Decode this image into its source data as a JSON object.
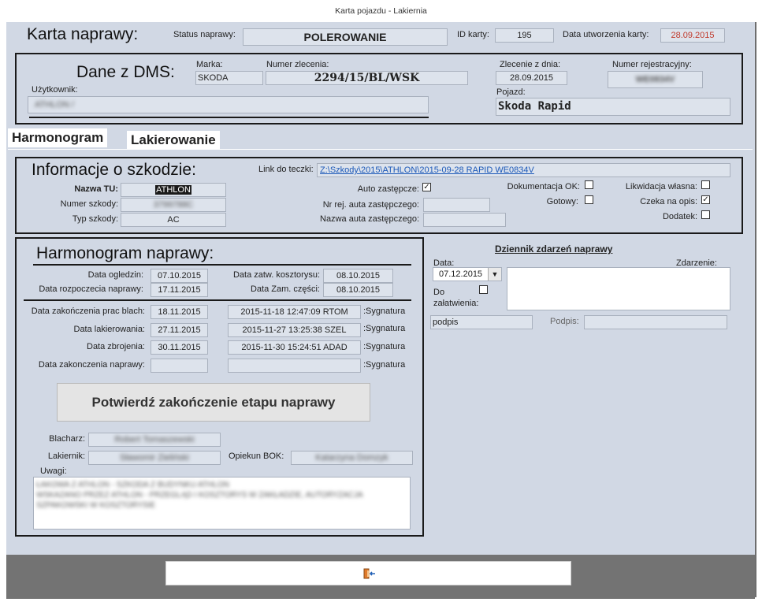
{
  "window": {
    "title": "Karta pojazdu - Lakiernia"
  },
  "header": {
    "title": "Karta naprawy:",
    "status_label": "Status naprawy:",
    "status_value": "POLEROWANIE",
    "id_label": "ID karty:",
    "id_value": "195",
    "created_label": "Data utworzenia karty:",
    "created_value": "28.09.2015",
    "created_color": "#c0392b"
  },
  "dms": {
    "title": "Dane z DMS:",
    "make_label": "Marka:",
    "make_value": "SKODA",
    "order_label": "Numer zlecenia:",
    "order_value": "2294/15/BL/WSK",
    "order_date_label": "Zlecenie z dnia:",
    "order_date_value": "28.09.2015",
    "reg_label": "Numer rejestracyjny:",
    "reg_value": "WE0834V",
    "user_label": "Użytkownik:",
    "user_value": "ATHLON /",
    "vehicle_label": "Pojazd:",
    "vehicle_value": "Skoda Rapid"
  },
  "tabs": [
    {
      "label": "Harmonogram"
    },
    {
      "label": "Lakierowanie"
    }
  ],
  "damage": {
    "title": "Informacje o szkodzie:",
    "link_label": "Link do teczki:",
    "link_value": "Z:\\Szkody\\2015\\ATHLON\\2015-09-28 RAPID WE0834V",
    "insurer_label": "Nazwa TU:",
    "insurer_value": "ATHLON",
    "claim_no_label": "Numer szkody:",
    "claim_no_value": "3799788C",
    "claim_type_label": "Typ szkody:",
    "claim_type_value": "AC",
    "rental_label": "Auto zastępcze:",
    "rental_checked": "✓",
    "rental_reg_label": "Nr rej. auta zastępczego:",
    "rental_reg_value": "",
    "rental_name_label": "Nazwa auta zastępczego:",
    "rental_name_value": "",
    "docs_label": "Dokumentacja OK:",
    "docs_checked": "",
    "ready_label": "Gotowy:",
    "ready_checked": "",
    "own_label": "Likwidacja własna:",
    "own_checked": "",
    "waiting_label": "Czeka na opis:",
    "waiting_checked": "✓",
    "extra_label": "Dodatek:",
    "extra_checked": ""
  },
  "schedule": {
    "title": "Harmonogram naprawy:",
    "inspection_label": "Data ogledzin:",
    "inspection_value": "07.10.2015",
    "cost_approved_label": "Data zatw. kosztorysu:",
    "cost_approved_value": "08.10.2015",
    "repair_start_label": "Data rozpoczecia naprawy:",
    "repair_start_value": "17.11.2015",
    "parts_order_label": "Data Zam. części:",
    "parts_order_value": "08.10.2015",
    "rows": [
      {
        "label": "Data zakończenia prac blach:",
        "date": "18.11.2015",
        "signature": "2015-11-18 12:47:09 RTOM",
        "sig_label": ":Sygnatura"
      },
      {
        "label": "Data lakierowania:",
        "date": "27.11.2015",
        "signature": "2015-11-27 13:25:38 SZEL",
        "sig_label": ":Sygnatura"
      },
      {
        "label": "Data zbrojenia:",
        "date": "30.11.2015",
        "signature": "2015-11-30 15:24:51 ADAD",
        "sig_label": ":Sygnatura"
      },
      {
        "label": "Data zakonczenia naprawy:",
        "date": "",
        "signature": "",
        "sig_label": ":Sygnatura"
      }
    ],
    "confirm_button": "Potwierdź zakończenie etapu naprawy",
    "body_label": "Blacharz:",
    "body_value": "Robert Tomaszewski",
    "painter_label": "Lakiernik:",
    "painter_value": "Sławomir Zieliński",
    "guardian_label": "Opiekun BOK:",
    "guardian_value": "Katarzyna Domzyk",
    "notes_label": "Uwagi:",
    "notes_lines": [
      "ŁAKOWA Z ATHLON - SZKODA Z BUDYNKU ATHLON",
      "WSKAZANO PRZEZ ATHLON - PRZEGLĄD I KOSZTORYS W ZAKŁADZIE, AUTORYZACJA",
      "SZPAKOWSKI W KOSZTORYSIE"
    ]
  },
  "log": {
    "title": "Dziennik zdarzeń naprawy",
    "date_label": "Data:",
    "date_value": "07.12.2015",
    "event_label": "Zdarzenie:",
    "event_value": "",
    "todo_label": "Do załatwienia:",
    "todo_checked": "",
    "sign_placeholder": "podpis",
    "sign_label": "Podpis:",
    "sign_value": ""
  },
  "footer": {
    "exit_icon": "exit-door-icon",
    "exit_color": "#e07a2a"
  }
}
